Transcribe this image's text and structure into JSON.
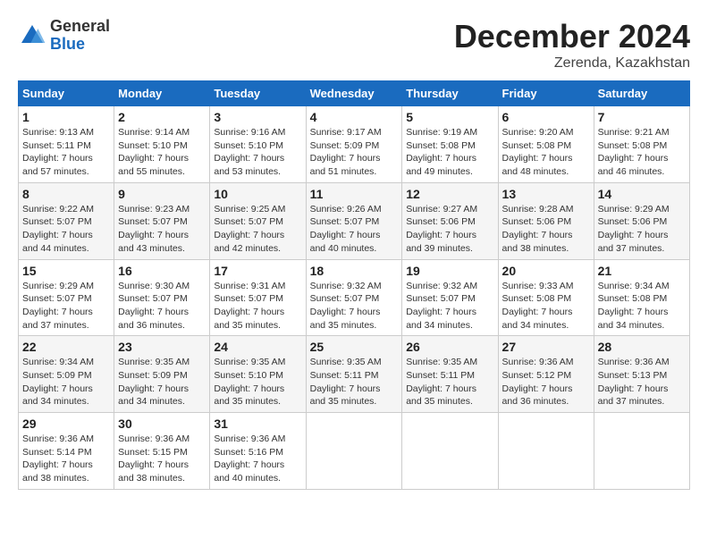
{
  "header": {
    "logo_line1": "General",
    "logo_line2": "Blue",
    "month_title": "December 2024",
    "location": "Zerenda, Kazakhstan"
  },
  "weekdays": [
    "Sunday",
    "Monday",
    "Tuesday",
    "Wednesday",
    "Thursday",
    "Friday",
    "Saturday"
  ],
  "weeks": [
    [
      {
        "day": "1",
        "sunrise": "9:13 AM",
        "sunset": "5:11 PM",
        "daylight": "7 hours and 57 minutes."
      },
      {
        "day": "2",
        "sunrise": "9:14 AM",
        "sunset": "5:10 PM",
        "daylight": "7 hours and 55 minutes."
      },
      {
        "day": "3",
        "sunrise": "9:16 AM",
        "sunset": "5:10 PM",
        "daylight": "7 hours and 53 minutes."
      },
      {
        "day": "4",
        "sunrise": "9:17 AM",
        "sunset": "5:09 PM",
        "daylight": "7 hours and 51 minutes."
      },
      {
        "day": "5",
        "sunrise": "9:19 AM",
        "sunset": "5:08 PM",
        "daylight": "7 hours and 49 minutes."
      },
      {
        "day": "6",
        "sunrise": "9:20 AM",
        "sunset": "5:08 PM",
        "daylight": "7 hours and 48 minutes."
      },
      {
        "day": "7",
        "sunrise": "9:21 AM",
        "sunset": "5:08 PM",
        "daylight": "7 hours and 46 minutes."
      }
    ],
    [
      {
        "day": "8",
        "sunrise": "9:22 AM",
        "sunset": "5:07 PM",
        "daylight": "7 hours and 44 minutes."
      },
      {
        "day": "9",
        "sunrise": "9:23 AM",
        "sunset": "5:07 PM",
        "daylight": "7 hours and 43 minutes."
      },
      {
        "day": "10",
        "sunrise": "9:25 AM",
        "sunset": "5:07 PM",
        "daylight": "7 hours and 42 minutes."
      },
      {
        "day": "11",
        "sunrise": "9:26 AM",
        "sunset": "5:07 PM",
        "daylight": "7 hours and 40 minutes."
      },
      {
        "day": "12",
        "sunrise": "9:27 AM",
        "sunset": "5:06 PM",
        "daylight": "7 hours and 39 minutes."
      },
      {
        "day": "13",
        "sunrise": "9:28 AM",
        "sunset": "5:06 PM",
        "daylight": "7 hours and 38 minutes."
      },
      {
        "day": "14",
        "sunrise": "9:29 AM",
        "sunset": "5:06 PM",
        "daylight": "7 hours and 37 minutes."
      }
    ],
    [
      {
        "day": "15",
        "sunrise": "9:29 AM",
        "sunset": "5:07 PM",
        "daylight": "7 hours and 37 minutes."
      },
      {
        "day": "16",
        "sunrise": "9:30 AM",
        "sunset": "5:07 PM",
        "daylight": "7 hours and 36 minutes."
      },
      {
        "day": "17",
        "sunrise": "9:31 AM",
        "sunset": "5:07 PM",
        "daylight": "7 hours and 35 minutes."
      },
      {
        "day": "18",
        "sunrise": "9:32 AM",
        "sunset": "5:07 PM",
        "daylight": "7 hours and 35 minutes."
      },
      {
        "day": "19",
        "sunrise": "9:32 AM",
        "sunset": "5:07 PM",
        "daylight": "7 hours and 34 minutes."
      },
      {
        "day": "20",
        "sunrise": "9:33 AM",
        "sunset": "5:08 PM",
        "daylight": "7 hours and 34 minutes."
      },
      {
        "day": "21",
        "sunrise": "9:34 AM",
        "sunset": "5:08 PM",
        "daylight": "7 hours and 34 minutes."
      }
    ],
    [
      {
        "day": "22",
        "sunrise": "9:34 AM",
        "sunset": "5:09 PM",
        "daylight": "7 hours and 34 minutes."
      },
      {
        "day": "23",
        "sunrise": "9:35 AM",
        "sunset": "5:09 PM",
        "daylight": "7 hours and 34 minutes."
      },
      {
        "day": "24",
        "sunrise": "9:35 AM",
        "sunset": "5:10 PM",
        "daylight": "7 hours and 35 minutes."
      },
      {
        "day": "25",
        "sunrise": "9:35 AM",
        "sunset": "5:11 PM",
        "daylight": "7 hours and 35 minutes."
      },
      {
        "day": "26",
        "sunrise": "9:35 AM",
        "sunset": "5:11 PM",
        "daylight": "7 hours and 35 minutes."
      },
      {
        "day": "27",
        "sunrise": "9:36 AM",
        "sunset": "5:12 PM",
        "daylight": "7 hours and 36 minutes."
      },
      {
        "day": "28",
        "sunrise": "9:36 AM",
        "sunset": "5:13 PM",
        "daylight": "7 hours and 37 minutes."
      }
    ],
    [
      {
        "day": "29",
        "sunrise": "9:36 AM",
        "sunset": "5:14 PM",
        "daylight": "7 hours and 38 minutes."
      },
      {
        "day": "30",
        "sunrise": "9:36 AM",
        "sunset": "5:15 PM",
        "daylight": "7 hours and 38 minutes."
      },
      {
        "day": "31",
        "sunrise": "9:36 AM",
        "sunset": "5:16 PM",
        "daylight": "7 hours and 40 minutes."
      },
      null,
      null,
      null,
      null
    ]
  ]
}
